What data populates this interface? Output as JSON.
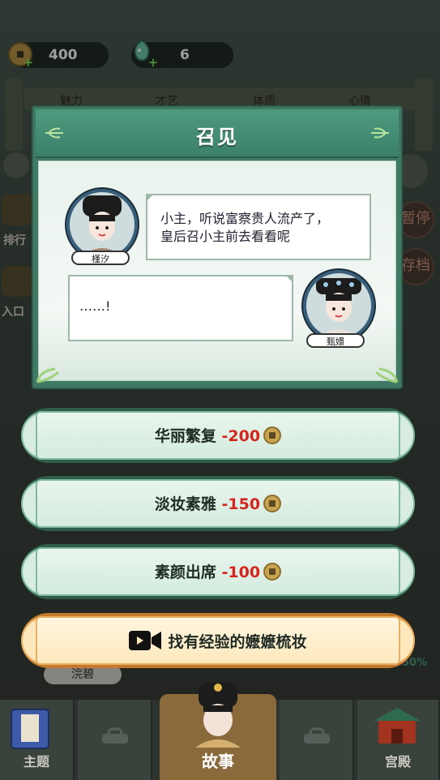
{
  "resources": {
    "coins": "400",
    "gems": "6"
  },
  "background": {
    "stats": [
      "魅力",
      "才艺",
      "体质",
      "心情"
    ],
    "side_left": [
      "排行",
      "入口"
    ],
    "side_right": [
      "暂停",
      "存档"
    ],
    "character_name": "浣碧",
    "percent": "50%"
  },
  "dialog": {
    "title": "召见",
    "speaker1": {
      "name": "槿汐",
      "text_line1": "小主，听说富察贵人流产了，",
      "text_line2": "皇后召小主前去看看呢"
    },
    "speaker2": {
      "name": "甄嬛",
      "text": "……!"
    }
  },
  "options": [
    {
      "label": "华丽繁复",
      "cost": "-200"
    },
    {
      "label": "淡妆素雅",
      "cost": "-150"
    },
    {
      "label": "素颜出席",
      "cost": "-100"
    }
  ],
  "video_option": {
    "label": "找有经验的嬷嬷梳妆",
    "icon": "video-camera-icon"
  },
  "nav": {
    "items": [
      "主题",
      "故事",
      "宫殿"
    ]
  },
  "colors": {
    "dialog_green": "#3f7a65",
    "cost_red": "#d3261f",
    "gold_button": "#c47a2b"
  }
}
